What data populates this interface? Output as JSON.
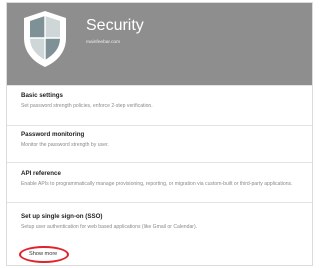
{
  "header": {
    "title": "Security",
    "subtitle": "mainfeebar.com"
  },
  "sections": [
    {
      "title": "Basic settings",
      "description": "Set password strength policies, enforce 2-step verification."
    },
    {
      "title": "Password monitoring",
      "description": "Monitor the password strength by user."
    },
    {
      "title": "API reference",
      "description": "Enable APIs to programmatically manage provisioning, reporting, or migration via custom-built or third-party applications."
    },
    {
      "title": "Set up single sign-on (SSO)",
      "description": "Setup user authentication for web based applications (like Gmail or Calendar)."
    }
  ],
  "show_more": {
    "label": "Show more",
    "highlight_color": "#e0222a"
  },
  "icons": {
    "header": "shield-icon"
  },
  "colors": {
    "header_bg": "#8e8e8e",
    "shield_light": "#cfd6d8",
    "shield_dark": "#7e9196"
  }
}
